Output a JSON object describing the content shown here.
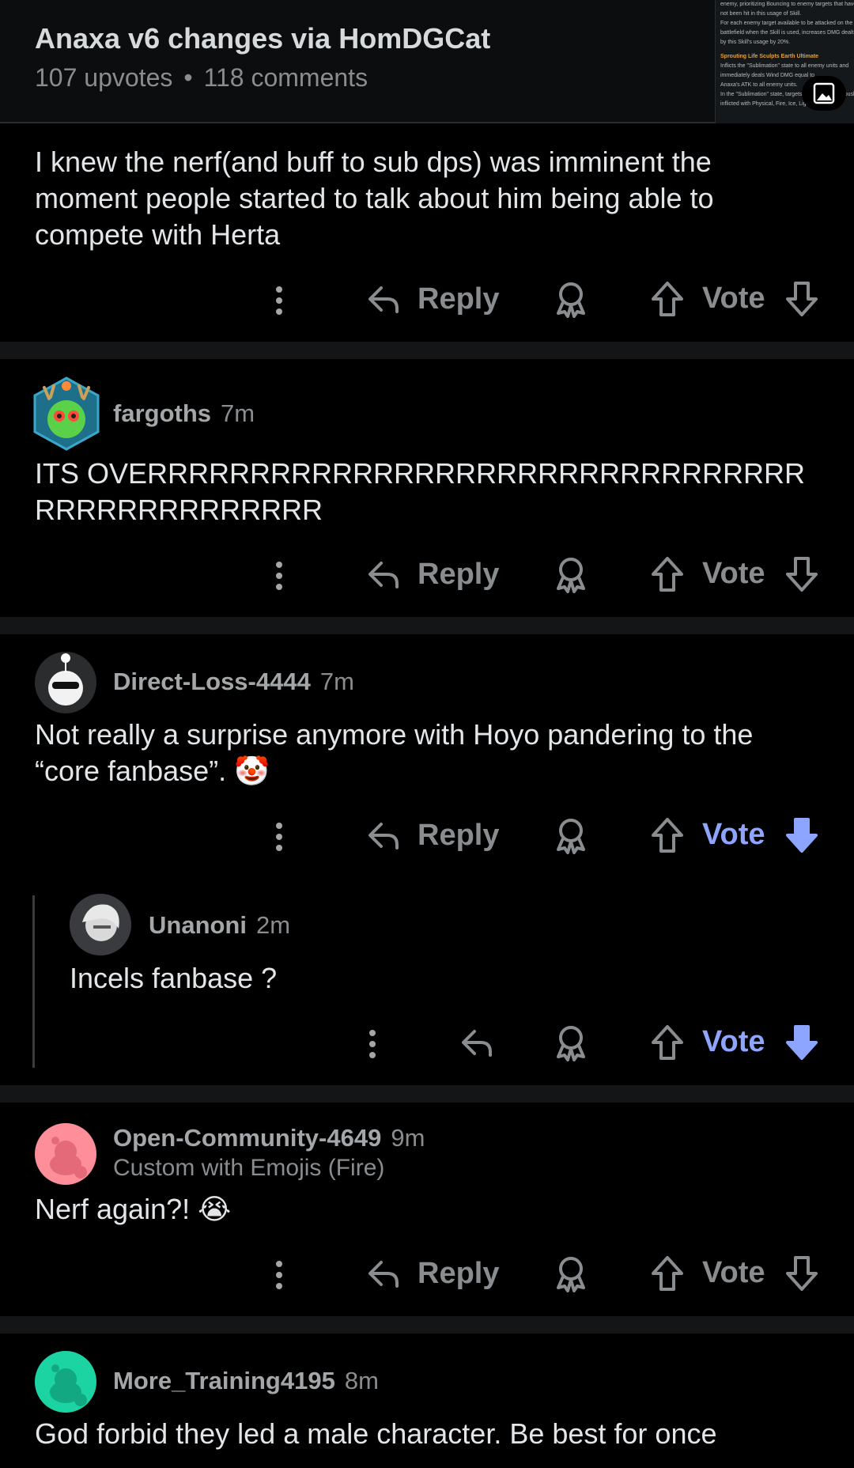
{
  "header": {
    "title": "Anaxa v6 changes via HomDGCat",
    "upvotes": "107 upvotes",
    "separator": "•",
    "comments": "118 comments",
    "thumbnail_lines": [
      "enemy, prioritizing Bouncing to enemy targets that have",
      "not been hit in this usage of Skill.",
      "For each enemy target available to be attacked on the",
      "battlefield when the Skill is used, increases DMG dealt",
      "by this Skill's usage by 20%."
    ],
    "thumbnail_heading": "Sprouting Life Sculpts Earth  Ultimate",
    "thumbnail_lines2": [
      "Inflicts the \"Sublimation\" state to all enemy units and",
      "immediately deals Wind DMG equal to",
      "Anaxa's ATK to all enemy units.",
      "In the \"Sublimation\" state, targets will be simultaneously",
      "inflicted with Physical, Fire, Ice, Lightning, Wind,"
    ]
  },
  "actions": {
    "reply_label": "Reply",
    "vote_label": "Vote"
  },
  "comments": [
    {
      "body": "I knew the nerf(and buff to sub dps) was imminent the moment people started to talk about him being able to compete with Herta",
      "voted": false
    },
    {
      "author": "fargoths",
      "time": "7m",
      "body": "ITS OVERRRRRRRRRRRRRRRRRRRRRRRRRRRRRRRRRRRRRRRRRRRRRR",
      "voted": false
    },
    {
      "author": "Direct-Loss-4444",
      "time": "7m",
      "body": "Not really a surprise anymore with Hoyo pandering to the “core fanbase”. 🤡",
      "voted": true
    },
    {
      "author": "Unanoni",
      "time": "2m",
      "body": "Incels fanbase ?",
      "voted": true,
      "is_reply": true
    },
    {
      "author": "Open-Community-4649",
      "time": "9m",
      "flair": "Custom with Emojis (Fire)",
      "body": "Nerf again?! 😭",
      "voted": false
    },
    {
      "author": "More_Training4195",
      "time": "8m",
      "body": "God forbid they led a male character. Be best for once"
    }
  ],
  "colors": {
    "background": "#000000",
    "separator": "#131516",
    "muted": "#8a8d90",
    "downvote_active": "#8ea5ff",
    "snoo_pink": "#ff8e9b",
    "snoo_teal": "#1bd4a2"
  }
}
